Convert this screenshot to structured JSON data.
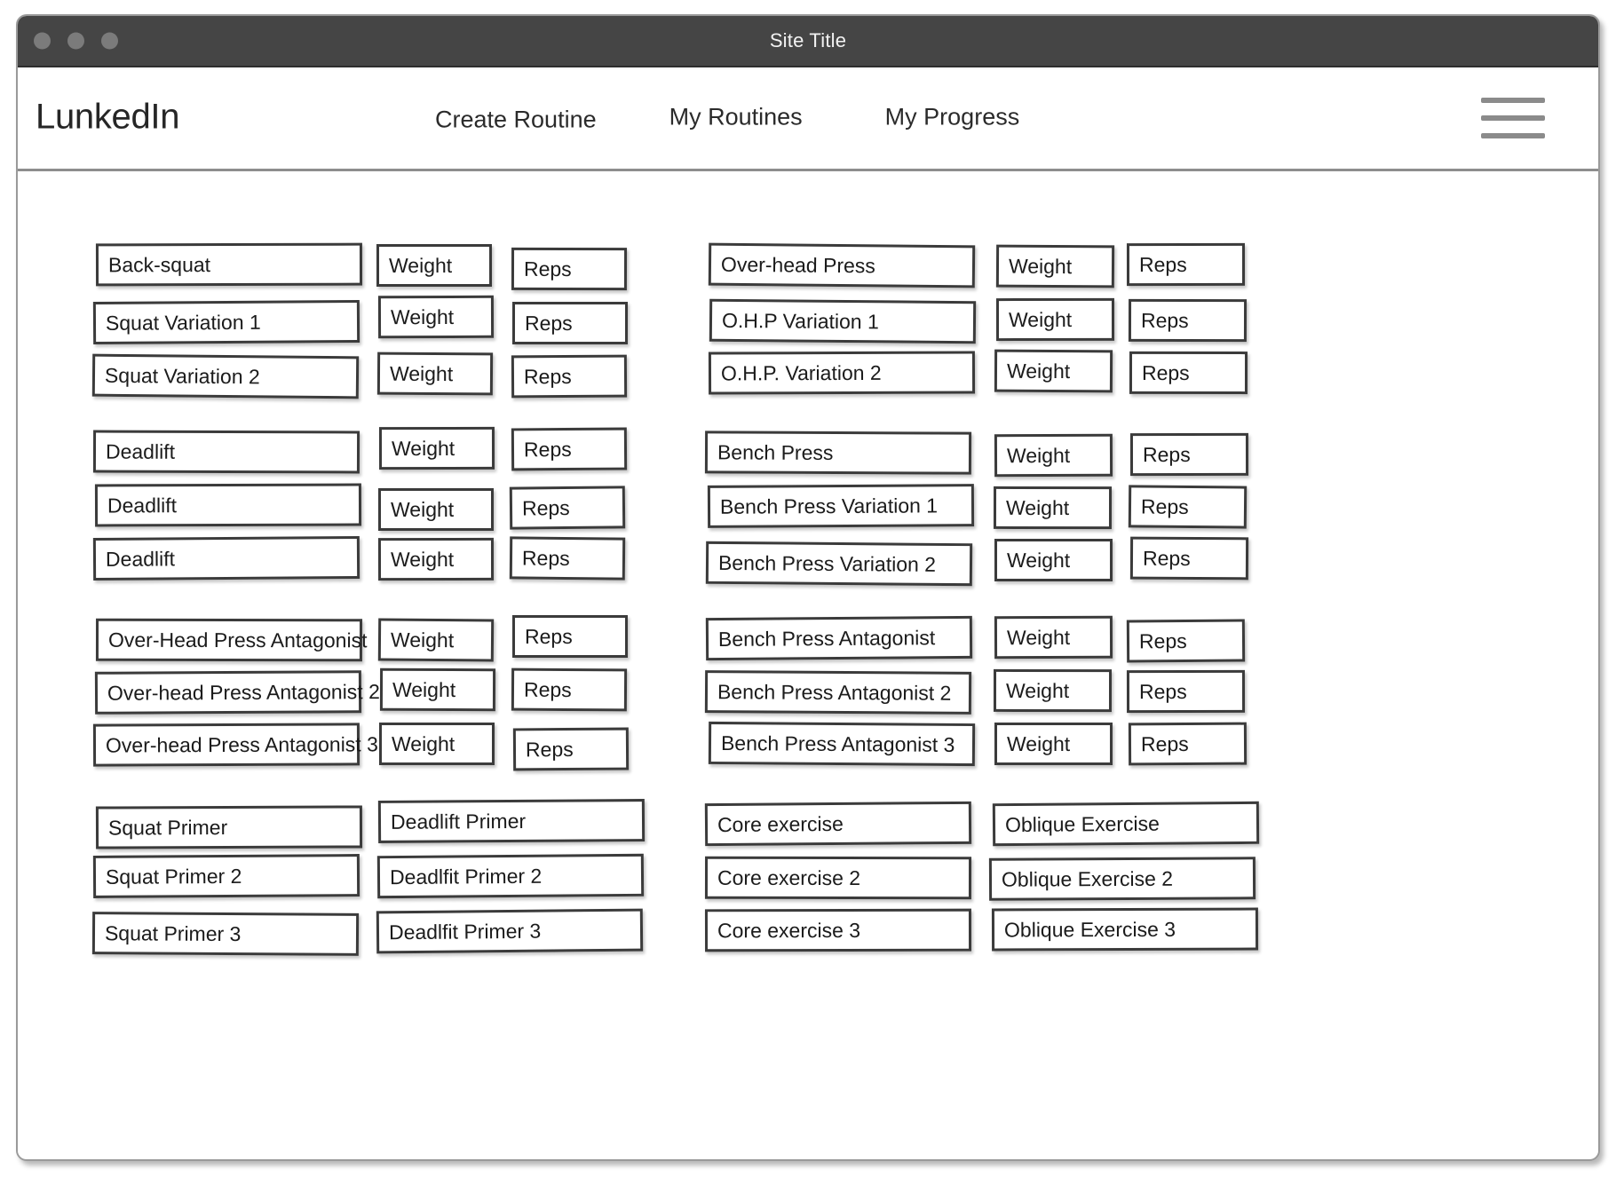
{
  "window": {
    "title": "Site Title",
    "traffic_lights": [
      "window-dot-1",
      "window-dot-2",
      "window-dot-3"
    ]
  },
  "navbar": {
    "brand": "LunkedIn",
    "links": [
      {
        "label": "Create Routine"
      },
      {
        "label": "My Routines"
      },
      {
        "label": "My Progress"
      }
    ],
    "menu_icon": "hamburger-icon"
  },
  "labels": {
    "weight": "Weight",
    "reps": "Reps"
  },
  "groups": [
    {
      "id": "squat-ohp-group",
      "left": {
        "rows": [
          {
            "exercise": "Back-squat",
            "weight": "Weight",
            "reps": "Reps"
          },
          {
            "exercise": "Squat Variation 1",
            "weight": "Weight",
            "reps": "Reps"
          },
          {
            "exercise": "Squat Variation 2",
            "weight": "Weight",
            "reps": "Reps"
          }
        ]
      },
      "right": {
        "rows": [
          {
            "exercise": "Over-head Press",
            "weight": "Weight",
            "reps": "Reps"
          },
          {
            "exercise": "O.H.P Variation 1",
            "weight": "Weight",
            "reps": "Reps"
          },
          {
            "exercise": "O.H.P. Variation 2",
            "weight": "Weight",
            "reps": "Reps"
          }
        ]
      }
    },
    {
      "id": "deadlift-bench-group",
      "left": {
        "rows": [
          {
            "exercise": "Deadlift",
            "weight": "Weight",
            "reps": "Reps"
          },
          {
            "exercise": "Deadlift",
            "weight": "Weight",
            "reps": "Reps"
          },
          {
            "exercise": "Deadlift",
            "weight": "Weight",
            "reps": "Reps"
          }
        ]
      },
      "right": {
        "rows": [
          {
            "exercise": "Bench Press",
            "weight": "Weight",
            "reps": "Reps"
          },
          {
            "exercise": "Bench Press Variation 1",
            "weight": "Weight",
            "reps": "Reps"
          },
          {
            "exercise": "Bench Press Variation 2",
            "weight": "Weight",
            "reps": "Reps"
          }
        ]
      }
    },
    {
      "id": "antagonist-group",
      "left": {
        "rows": [
          {
            "exercise": "Over-Head Press Antagonist",
            "weight": "Weight",
            "reps": "Reps"
          },
          {
            "exercise": "Over-head Press Antagonist 2",
            "weight": "Weight",
            "reps": "Reps"
          },
          {
            "exercise": "Over-head Press Antagonist 3",
            "weight": "Weight",
            "reps": "Reps"
          }
        ]
      },
      "right": {
        "rows": [
          {
            "exercise": "Bench Press Antagonist",
            "weight": "Weight",
            "reps": "Reps"
          },
          {
            "exercise": "Bench Press Antagonist 2",
            "weight": "Weight",
            "reps": "Reps"
          },
          {
            "exercise": "Bench Press Antagonist 3",
            "weight": "Weight",
            "reps": "Reps"
          }
        ]
      }
    },
    {
      "id": "primer-core-group",
      "left": {
        "rows": [
          {
            "col1": "Squat Primer",
            "col2": "Deadlift Primer"
          },
          {
            "col1": "Squat Primer 2",
            "col2": "Deadlfit Primer 2"
          },
          {
            "col1": "Squat Primer 3",
            "col2": "Deadlfit Primer 3"
          }
        ]
      },
      "right": {
        "rows": [
          {
            "col1": "Core exercise",
            "col2": "Oblique Exercise"
          },
          {
            "col1": "Core exercise 2",
            "col2": "Oblique Exercise 2"
          },
          {
            "col1": "Core exercise 3",
            "col2": "Oblique Exercise 3"
          }
        ]
      }
    }
  ]
}
